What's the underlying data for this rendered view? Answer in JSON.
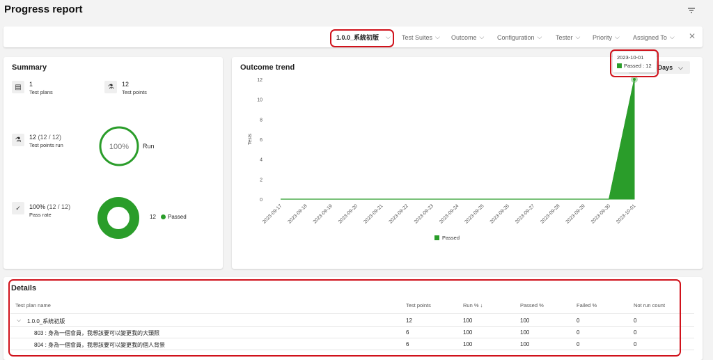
{
  "page": {
    "title": "Progress report",
    "filter_icon": "filter-icon"
  },
  "filters": {
    "selected_plan": "1.0.0_系統初版",
    "items": [
      {
        "label": "Test Suites"
      },
      {
        "label": "Outcome"
      },
      {
        "label": "Configuration"
      },
      {
        "label": "Tester"
      },
      {
        "label": "Priority"
      },
      {
        "label": "Assigned To"
      }
    ],
    "close_icon": "close-icon"
  },
  "summary": {
    "title": "Summary",
    "test_plans": {
      "value": "1",
      "label": "Test plans"
    },
    "test_points": {
      "value": "12",
      "label": "Test points"
    },
    "points_run": {
      "value": "12",
      "detail": "(12 / 12)",
      "label": "Test points run"
    },
    "run_donut": {
      "percent_text": "100%",
      "label": "Run",
      "fraction": 1.0
    },
    "pass_rate": {
      "value": "100%",
      "detail": "(12 / 12)",
      "label": "Pass rate"
    },
    "pass_donut": {
      "count": "12",
      "legend": "Passed",
      "fraction": 1.0
    },
    "colors": {
      "passed": "#2a9d2a"
    }
  },
  "trend": {
    "title": "Outcome trend",
    "period_label": "4 Days",
    "tooltip": {
      "date": "2023-10-01",
      "text": "Passed : 12"
    }
  },
  "chart_data": {
    "type": "area",
    "x": [
      "2023-09-17",
      "2023-09-18",
      "2023-09-19",
      "2023-09-20",
      "2023-09-21",
      "2023-09-22",
      "2023-09-23",
      "2023-09-24",
      "2023-09-25",
      "2023-09-26",
      "2023-09-27",
      "2023-09-28",
      "2023-09-29",
      "2023-09-30",
      "2023-10-01"
    ],
    "series": [
      {
        "name": "Passed",
        "values": [
          0,
          0,
          0,
          0,
          0,
          0,
          0,
          0,
          0,
          0,
          0,
          0,
          0,
          0,
          12
        ],
        "color": "#2a9d2a"
      }
    ],
    "ylabel": "Tests",
    "ylim": [
      0,
      12
    ],
    "yticks": [
      0,
      2,
      4,
      6,
      8,
      10,
      12
    ],
    "legend": "bottom",
    "grid": false
  },
  "details": {
    "title": "Details",
    "headers": {
      "name": "Test plan name",
      "points": "Test points",
      "run": "Run % ↓",
      "passed": "Passed %",
      "failed": "Failed %",
      "notrun": "Not run count"
    },
    "rows": [
      {
        "name": "1.0.0_系統初版",
        "points": "12",
        "run": "100",
        "passed": "100",
        "failed": "0",
        "notrun": "0"
      },
      {
        "name": "803 : 身為一個會員，我想該要可以變更我的大頭照",
        "points": "6",
        "run": "100",
        "passed": "100",
        "failed": "0",
        "notrun": "0"
      },
      {
        "name": "804 : 身為一個會員，我想該要可以變更我的個人背景",
        "points": "6",
        "run": "100",
        "passed": "100",
        "failed": "0",
        "notrun": "0"
      }
    ]
  }
}
